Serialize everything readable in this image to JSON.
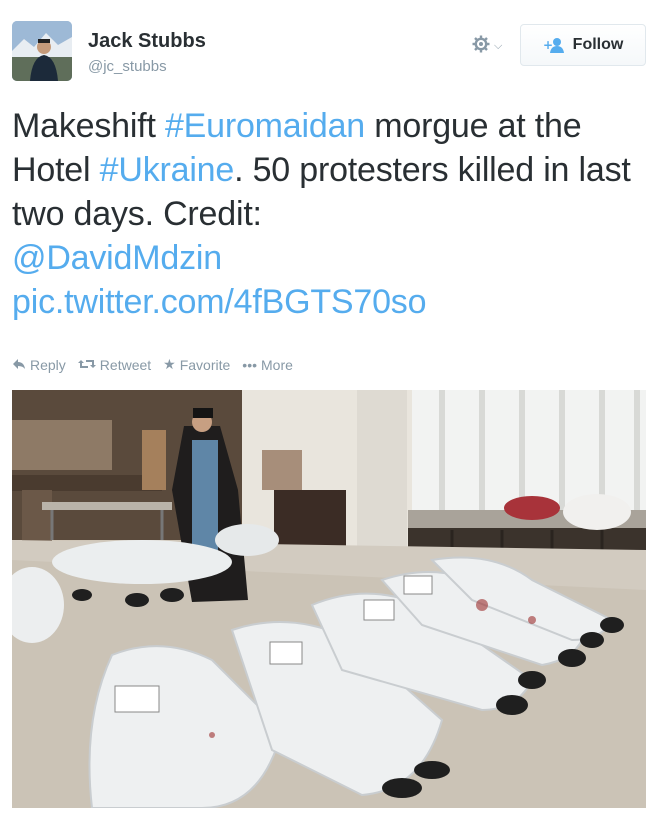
{
  "user": {
    "display_name": "Jack Stubbs",
    "screen_name": "@jc_stubbs",
    "avatar_icon": "profile-photo"
  },
  "header": {
    "gear_icon": "gear-icon",
    "follow_label": "Follow",
    "follow_icon": "add-user-icon"
  },
  "tweet": {
    "part1": "Makeshift ",
    "hashtag1": "#Euromaidan",
    "part2": " morgue at the Hotel ",
    "hashtag2": "#Ukraine",
    "part3": ". 50 protesters killed in last two days. Credit: ",
    "mention": "@DavidMdzin",
    "link": "pic.twitter.com/4fBGTS70so"
  },
  "actions": {
    "reply": "Reply",
    "retweet": "Retweet",
    "favorite": "Favorite",
    "more": "More"
  },
  "colors": {
    "link": "#55acee",
    "text": "#292f33",
    "muted": "#8899a6"
  }
}
